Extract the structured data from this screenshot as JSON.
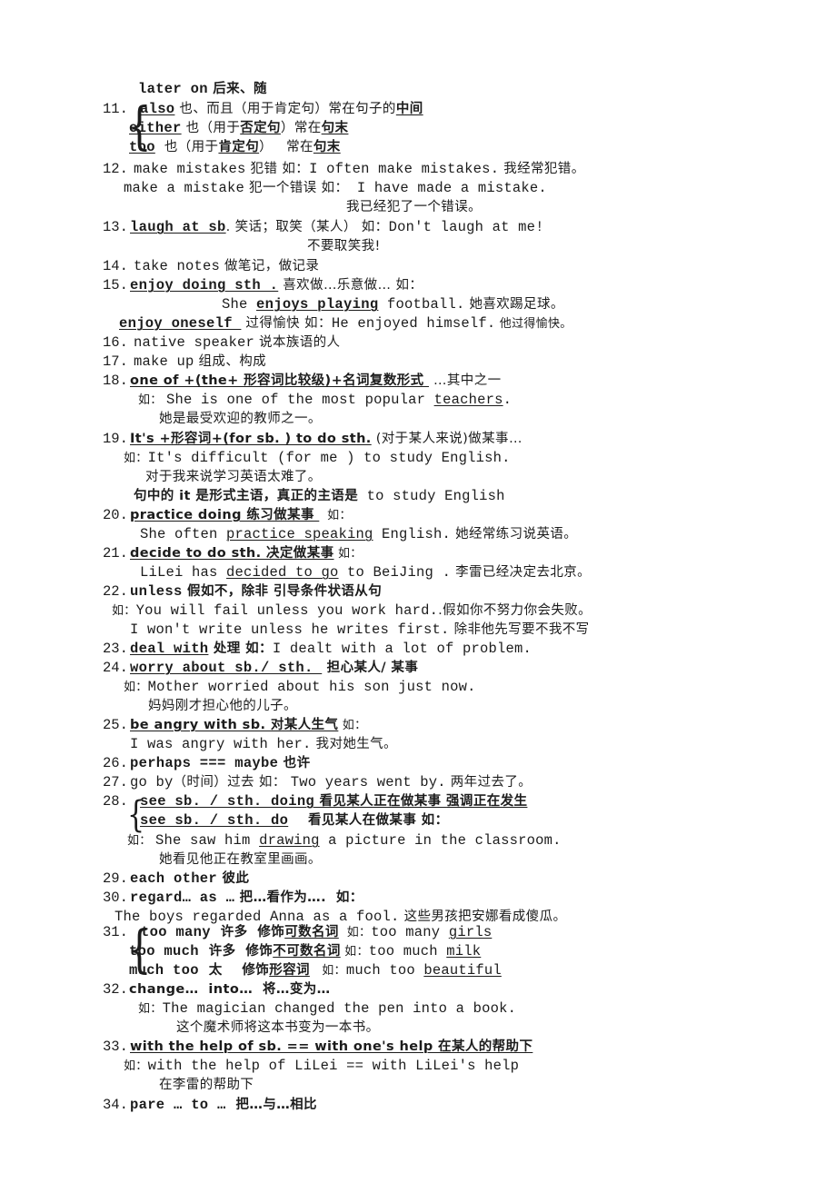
{
  "document": {
    "type": "study-notes",
    "language": "en-zh",
    "header_line": "later on  后来、随"
  },
  "entries": [
    {
      "number": "11.",
      "grouped": true,
      "lines": [
        {
          "headword": "also",
          "rest": " 也、而且（用于肯定句）常在句子的",
          "tail_underline": "中间"
        },
        {
          "headword": "either",
          "rest": " 也（用于",
          "mid_underline": "否定句",
          "rest2": "）常在",
          "tail_underline": "句末"
        },
        {
          "headword": "too",
          "rest": "  也（用于",
          "mid_underline": "肯定句",
          "rest2": "）   常在",
          "tail_underline": "句末"
        }
      ]
    },
    {
      "number": "12.",
      "lines": [
        "make mistakes 犯错 如：I often make mistakes. 我经常犯错。",
        "make a mistake 犯一个错误 如： I have made a mistake.",
        "我已经犯了一个错误。"
      ]
    },
    {
      "number": "13.",
      "headword": "laugh at sb",
      "lines": [
        ". 笑话；取笑（某人） 如：Don't laugh at me!",
        "不要取笑我!"
      ]
    },
    {
      "number": "14.",
      "lines": [
        "take notes 做笔记，做记录"
      ]
    },
    {
      "number": "15.",
      "headword": "enjoy doing sth .",
      "lines": [
        " 喜欢做…乐意做… 如：",
        "She enjoys playing football. 她喜欢踢足球。",
        "enjoy oneself  过得愉快 如：He enjoyed himself. 他过得愉快。"
      ]
    },
    {
      "number": "16.",
      "lines": [
        "native speaker 说本族语的人"
      ]
    },
    {
      "number": "17.",
      "lines": [
        "make up 组成、构成"
      ]
    },
    {
      "number": "18.",
      "headword": "one of +(the+ 形容词比较级)+名词复数形式",
      "lines": [
        " …其中之一",
        "如： She is one of the most popular teachers.",
        "她是最受欢迎的教师之一。"
      ]
    },
    {
      "number": "19.",
      "headword": "It's +形容词+(for sb. ) to do sth.",
      "lines": [
        " (对于某人来说)做某事…",
        "如：It's difficult (for me ) to study English.",
        "对于我来说学习英语太难了。",
        "句中的 it 是形式主语，真正的主语是 to study English"
      ]
    },
    {
      "number": "20.",
      "headword": "practice doing 练习做某事",
      "lines": [
        "  如：",
        "She often practice speaking English. 她经常练习说英语。"
      ]
    },
    {
      "number": "21.",
      "headword": "decide to do sth. 决定做某事",
      "lines": [
        " 如：",
        "LiLei has decided to go to BeiJing . 李雷已经决定去北京。"
      ]
    },
    {
      "number": "22.",
      "lines": [
        "unless 假如不，除非 引导条件状语从句",
        "如：You will fail unless you work hard..假如你不努力你会失败。",
        "I won't write unless he writes first. 除非他先写要不我不写"
      ]
    },
    {
      "number": "23.",
      "headword": "deal with",
      "lines": [
        " 处理 如：I dealt with a lot of problem."
      ]
    },
    {
      "number": "24.",
      "headword": "worry about sb./ sth.",
      "lines": [
        " 担心某人/ 某事",
        "如：Mother worried about his son just now.",
        "妈妈刚才担心他的儿子。"
      ]
    },
    {
      "number": "25.",
      "headword": "be angry with sb. 对某人生气",
      "lines": [
        " 如：",
        "I was angry with her. 我对她生气。"
      ]
    },
    {
      "number": "26.",
      "lines": [
        "perhaps === maybe 也许"
      ]
    },
    {
      "number": "27.",
      "lines": [
        "go by（时间）过去 如： Two years went by. 两年过去了。"
      ]
    },
    {
      "number": "28.",
      "grouped": true,
      "lines": [
        "see sb. / sth. doing 看见某人正在做某事 强调正在发生",
        "see sb. / sth. do    看见某人在做某事 如：",
        "如： She saw him drawing a picture in the classroom.",
        "她看见他正在教室里画画。"
      ]
    },
    {
      "number": "29.",
      "lines": [
        "each other 彼此"
      ]
    },
    {
      "number": "30.",
      "lines": [
        "regard… as … 把…看作为….  如：",
        "The boys regarded Anna as a fool. 这些男孩把安娜看成傻瓜。"
      ]
    },
    {
      "number": "31.",
      "grouped": true,
      "lines": [
        "too many  许多  修饰可数名词  如：too many girls",
        "too much  许多  修饰不可数名词 如：too much milk",
        "much too  太    修饰形容词   如：much too beautiful"
      ]
    },
    {
      "number": "32.",
      "lines": [
        "change…  into…  将…变为…",
        "如：The magician changed the pen into a book.",
        "这个魔术师将这本书变为一本书。"
      ]
    },
    {
      "number": "33.",
      "headword": "with the help of sb. == with one's help 在某人的帮助下",
      "lines": [
        "如：with the help of LiLei == with LiLei's help",
        "在李雷的帮助下"
      ]
    },
    {
      "number": "34.",
      "lines": [
        "pare … to …  把…与…相比"
      ]
    }
  ],
  "text": {
    "header": "later on",
    "header_cn": " 后来、随",
    "n11": "11.",
    "e11a_hw": "also",
    "e11a_1": " 也、而且（用于肯定句）常在句子的",
    "e11a_u": "中间",
    "e11b_hw": "either",
    "e11b_1": " 也（用于",
    "e11b_u1": "否定句",
    "e11b_2": "）常在",
    "e11b_u2": "句末",
    "e11c_hw": "too",
    "e11c_1": "  也（用于",
    "e11c_u1": "肯定句",
    "e11c_2": "）   常在",
    "e11c_u2": "句末",
    "n12": "12.",
    "e12_1": "make mistakes",
    "e12_1cn": " 犯错 如：",
    "e12_1en": "I often make mistakes.",
    "e12_1cn2": " 我经常犯错。",
    "e12_2": "make a mistake",
    "e12_2cn": " 犯一个错误 如：",
    "e12_2en": " I have made a mistake.",
    "e12_3": "我已经犯了一个错误。",
    "n13": "13.",
    "e13_hw": "laugh at sb",
    "e13_1cn": ". 笑话；取笑（某人） 如：",
    "e13_1en": "Don't laugh at me!",
    "e13_2": "不要取笑我!",
    "n14": "14.",
    "e14_en": "take notes",
    "e14_cn": " 做笔记，做记录",
    "n15": "15.",
    "e15_hw": "enjoy doing sth .",
    "e15_cn": " 喜欢做…乐意做… 如：",
    "e15_2a": "She ",
    "e15_2u": "enjoys playing",
    "e15_2b": " football.",
    "e15_2cn": " 她喜欢踢足球。",
    "e15_3hw": "enjoy oneself ",
    "e15_3cn": " 过得愉快 如：",
    "e15_3en": "He enjoyed himself.",
    "e15_3cn2": " 他过得愉快。",
    "n16": "16.",
    "e16_en": "native speaker",
    "e16_cn": " 说本族语的人",
    "n17": "17.",
    "e17_en": "make up",
    "e17_cn": " 组成、构成",
    "n18": "18.",
    "e18_hw": "one of +(the+ 形容词比较级)+名词复数形式 ",
    "e18_cn": " …其中之一",
    "e18_2cn": "如： ",
    "e18_2en": "She is one of the most popular ",
    "e18_2u": "teachers",
    "e18_2end": ".",
    "e18_3": "她是最受欢迎的教师之一。",
    "n19": "19.",
    "e19_hw": "It's +形容词+(for sb. ) to do sth.",
    "e19_cn": " (对于某人来说)做某事…",
    "e19_2cn": "如：",
    "e19_2en": "It's difficult (for me ) to study English.",
    "e19_3": "对于我来说学习英语太难了。",
    "e19_4a": "句中的 it 是形式主语，真正的主语是",
    "e19_4b": " to study English",
    "n20": "20.",
    "e20_hw": "practice doing 练习做某事 ",
    "e20_cn": "  如：",
    "e20_2a": "She often ",
    "e20_2u": "practice speaking",
    "e20_2b": " English.",
    "e20_2cn": " 她经常练习说英语。",
    "n21": "21.",
    "e21_hw": "decide to do sth. 决定做某事",
    "e21_cn": " 如：",
    "e21_2a": "LiLei has ",
    "e21_2u": "decided to go",
    "e21_2b": " to BeiJing .",
    "e21_2cn": " 李雷已经决定去北京。",
    "n22": "22.",
    "e22_hw": "unless",
    "e22_cn": " 假如不，除非 引导条件状语从句",
    "e22_2cn": "如：",
    "e22_2en": "You will fail unless you work hard.",
    "e22_2cn2": ".假如你不努力你会失败。",
    "e22_3en": "I won't write unless he writes first.",
    "e22_3cn": " 除非他先写要不我不写",
    "n23": "23.",
    "e23_hw": "deal with",
    "e23_cn": " 处理 如：",
    "e23_en": "I dealt with a lot of problem.",
    "n24": "24.",
    "e24_hw": "worry about sb./ sth. ",
    "e24_cn": " 担心某人/ 某事",
    "e24_2cn": "如：",
    "e24_2en": "Mother worried about his son just now.",
    "e24_3": "妈妈刚才担心他的儿子。",
    "n25": "25.",
    "e25_hw": "be angry with sb. 对某人生气",
    "e25_cn": " 如：",
    "e25_2en": "I was angry with her.",
    "e25_2cn": " 我对她生气。",
    "n26": "26.",
    "e26_en": "perhaps === maybe",
    "e26_cn": " 也许",
    "n27": "27.",
    "e27_en": "go by",
    "e27_cn": "（时间）过去 如： ",
    "e27_en2": "Two years went by.",
    "e27_cn2": " 两年过去了。",
    "n28": "28.",
    "e28_hw1": "see sb. / sth. doing",
    "e28_cn1": " 看见某人正在做某事 ",
    "e28_u1": "强调正在发生",
    "e28_hw2": "see sb. / sth. do",
    "e28_cn2": "    看见某人在做某事 如：",
    "e28_3cn": "如： ",
    "e28_3a": "She saw him ",
    "e28_3u": "drawing",
    "e28_3b": " a picture in the classroom.",
    "e28_4": "她看见他正在教室里画画。",
    "n29": "29.",
    "e29_en": "each other",
    "e29_cn": " 彼此",
    "n30": "30.",
    "e30_en": "regard… as …",
    "e30_cn": " 把…看作为….  如：",
    "e30_2en": "The boys regarded Anna as a fool.",
    "e30_2cn": " 这些男孩把安娜看成傻瓜。",
    "n31": "31.",
    "e31a_hw": "too many",
    "e31a_cn1": "  许多  修饰",
    "e31a_u": "可数名词",
    "e31a_cn2": "  如：",
    "e31a_en": "too many ",
    "e31a_eu": "girls",
    "e31b_hw": "too much",
    "e31b_cn1": "  许多  修饰",
    "e31b_u": "不可数名词",
    "e31b_cn2": " 如：",
    "e31b_en": "too much ",
    "e31b_eu": "milk",
    "e31c_hw": "much too",
    "e31c_cn1": "  太    修饰",
    "e31c_u": "形容词",
    "e31c_cn2": "   如：",
    "e31c_en": "much too ",
    "e31c_eu": "beautiful",
    "n32": "32.",
    "e32_hw": "change…  into…  将…变为…",
    "e32_2cn": "如：",
    "e32_2en": "The magician changed the pen into a book.",
    "e32_3": "这个魔术师将这本书变为一本书。",
    "n33": "33.",
    "e33_hw": "with the help of sb. == with one's help 在某人的帮助下",
    "e33_2cn": "如：",
    "e33_2en": "with the help of LiLei == with LiLei's help",
    "e33_3": "在李雷的帮助下",
    "n34": "34.",
    "e34_en": "pare … to …",
    "e34_cn": "  把…与…相比"
  }
}
